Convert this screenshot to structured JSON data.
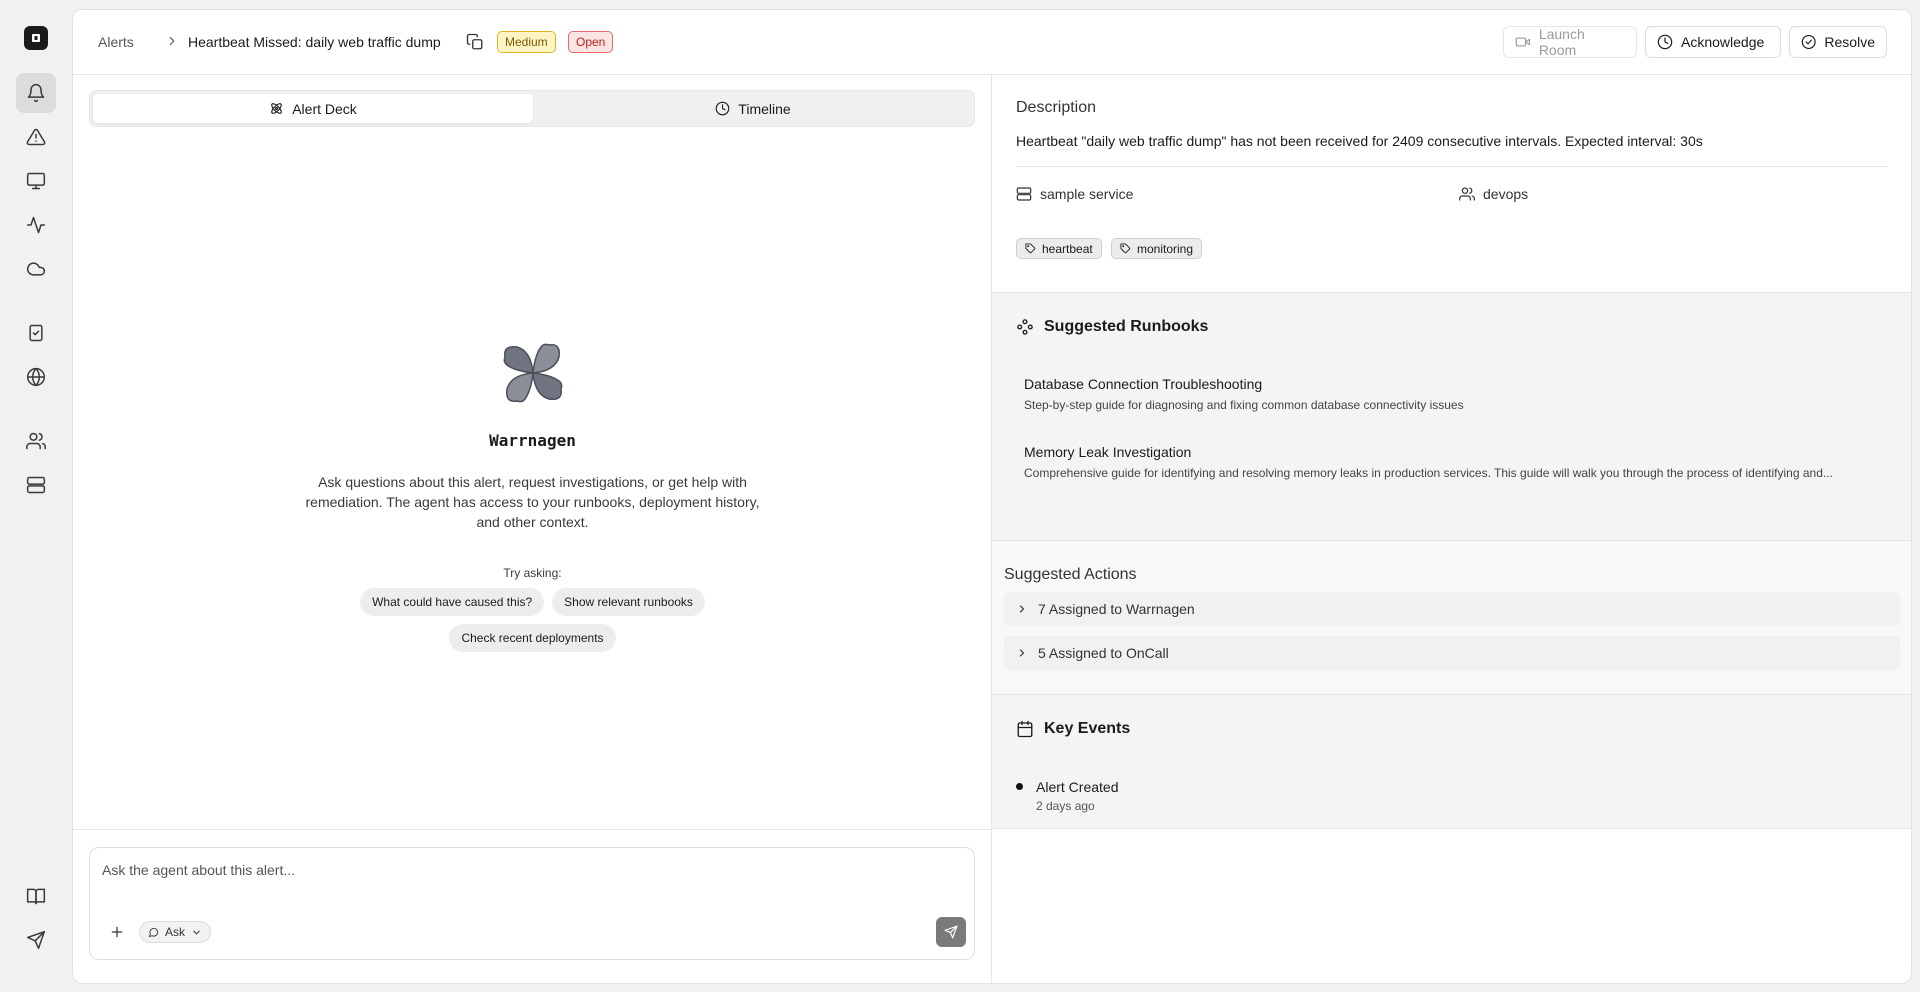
{
  "breadcrumb": {
    "root": "Alerts",
    "title": "Heartbeat Missed: daily web traffic dump"
  },
  "badges": {
    "severity": "Medium",
    "status": "Open"
  },
  "header_actions": {
    "launch_room": "Launch Room",
    "acknowledge": "Acknowledge",
    "resolve": "Resolve"
  },
  "sidebar": {
    "items": [
      "bell-icon",
      "alert-triangle-icon",
      "monitor-icon",
      "activity-icon",
      "cloud-icon",
      "clipboard-check-icon",
      "globe-icon",
      "users-icon",
      "server-icon"
    ],
    "bottom": [
      "book-icon",
      "send-icon"
    ]
  },
  "tabs": {
    "alert_deck": "Alert Deck",
    "timeline": "Timeline"
  },
  "agent": {
    "name": "Warrnagen",
    "description": "Ask questions about this alert, request investigations, or get help with remediation. The agent has access to your runbooks, deployment history, and other context.",
    "try_label": "Try asking:",
    "suggestions": [
      "What could have caused this?",
      "Show relevant runbooks",
      "Check recent deployments"
    ]
  },
  "chat_input": {
    "placeholder": "Ask the agent about this alert...",
    "mode": "Ask"
  },
  "description": {
    "label": "Description",
    "text": "Heartbeat \"daily web traffic dump\" has not been received for 2409 consecutive intervals. Expected interval: 30s",
    "service": "sample service",
    "team": "devops",
    "tags": [
      "heartbeat",
      "monitoring"
    ]
  },
  "runbooks": {
    "title": "Suggested Runbooks",
    "items": [
      {
        "title": "Database Connection Troubleshooting",
        "desc": "Step-by-step guide for diagnosing and fixing common database connectivity issues"
      },
      {
        "title": "Memory Leak Investigation",
        "desc": "Comprehensive guide for identifying and resolving memory leaks in production services. This guide will walk you through the process of identifying and..."
      }
    ]
  },
  "suggested_actions": {
    "title": "Suggested Actions",
    "groups": [
      "7 Assigned to Warrnagen",
      "5 Assigned to OnCall"
    ]
  },
  "key_events": {
    "title": "Key Events",
    "items": [
      {
        "title": "Alert Created",
        "time": "2 days ago"
      }
    ]
  },
  "colors": {
    "accent": "#1b1b1b",
    "medium_badge": "#fff5c4",
    "open_badge": "#fde4e4"
  }
}
